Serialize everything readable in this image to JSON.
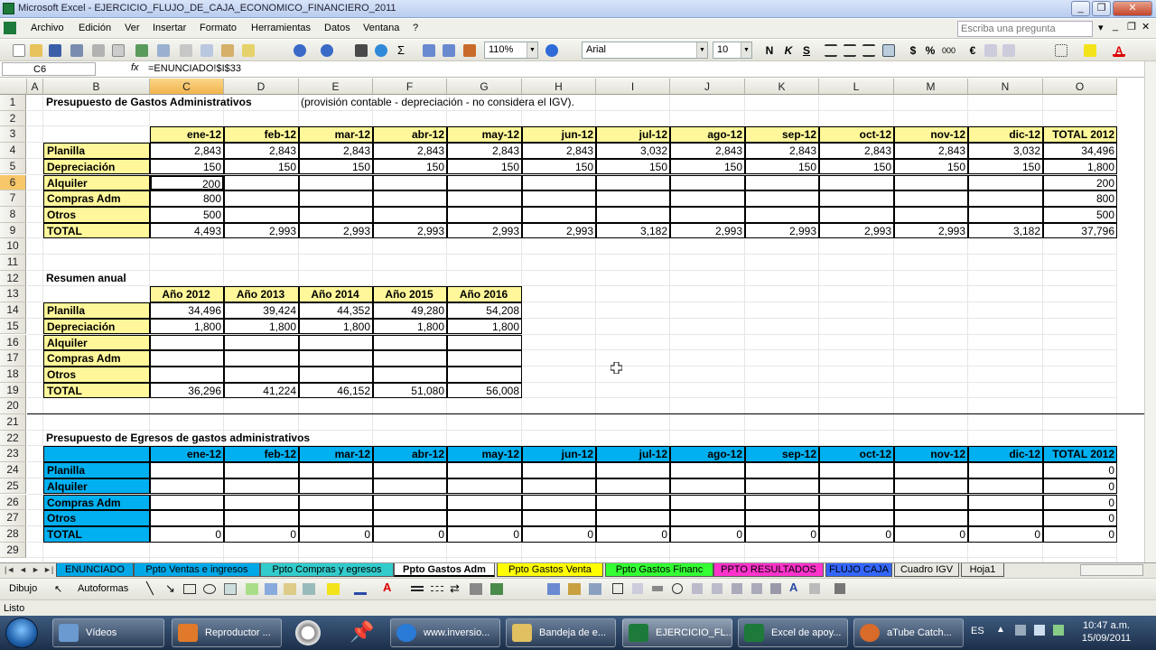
{
  "window": {
    "title": "Microsoft Excel - EJERCICIO_FLUJO_DE_CAJA_ECONOMICO_FINANCIERO_2011"
  },
  "menu": {
    "items": [
      "Archivo",
      "Edición",
      "Ver",
      "Insertar",
      "Formato",
      "Herramientas",
      "Datos",
      "Ventana",
      "?"
    ],
    "help_placeholder": "Escriba una pregunta"
  },
  "toolbar": {
    "zoom": "110%",
    "font": "Arial",
    "size": "10"
  },
  "formula_bar": {
    "name_box": "C6",
    "fx": "fx",
    "formula": "=ENUNCIADO!$I$33"
  },
  "columns": [
    "A",
    "B",
    "C",
    "D",
    "E",
    "F",
    "G",
    "H",
    "I",
    "J",
    "K",
    "L",
    "M",
    "N",
    "O"
  ],
  "rows": [
    "1",
    "2",
    "3",
    "4",
    "5",
    "6",
    "7",
    "8",
    "9",
    "10",
    "11",
    "12",
    "13",
    "14",
    "15",
    "16",
    "17",
    "18",
    "19",
    "20",
    "21",
    "22",
    "23",
    "24",
    "25",
    "26",
    "27",
    "28",
    "29"
  ],
  "sheet": {
    "title1": "Presupuesto de Gastos Administrativos",
    "subtitle1": "(provisión contable - depreciación - no considera el IGV).",
    "months": [
      "ene-12",
      "feb-12",
      "mar-12",
      "abr-12",
      "may-12",
      "jun-12",
      "jul-12",
      "ago-12",
      "sep-12",
      "oct-12",
      "nov-12",
      "dic-12",
      "TOTAL 2012"
    ],
    "t1_rows": [
      {
        "label": "Planilla",
        "values": [
          "2,843",
          "2,843",
          "2,843",
          "2,843",
          "2,843",
          "2,843",
          "3,032",
          "2,843",
          "2,843",
          "2,843",
          "2,843",
          "3,032",
          "34,496"
        ]
      },
      {
        "label": "Depreciación",
        "values": [
          "150",
          "150",
          "150",
          "150",
          "150",
          "150",
          "150",
          "150",
          "150",
          "150",
          "150",
          "150",
          "1,800"
        ]
      },
      {
        "label": "Alquiler",
        "values": [
          "200",
          "",
          "",
          "",
          "",
          "",
          "",
          "",
          "",
          "",
          "",
          "",
          "200"
        ]
      },
      {
        "label": "Compras Adm",
        "values": [
          "800",
          "",
          "",
          "",
          "",
          "",
          "",
          "",
          "",
          "",
          "",
          "",
          "800"
        ]
      },
      {
        "label": "Otros",
        "values": [
          "500",
          "",
          "",
          "",
          "",
          "",
          "",
          "",
          "",
          "",
          "",
          "",
          "500"
        ]
      },
      {
        "label": "TOTAL",
        "values": [
          "4,493",
          "2,993",
          "2,993",
          "2,993",
          "2,993",
          "2,993",
          "3,182",
          "2,993",
          "2,993",
          "2,993",
          "2,993",
          "3,182",
          "37,796"
        ]
      }
    ],
    "title2": "Resumen anual",
    "years": [
      "Año 2012",
      "Año 2013",
      "Año 2014",
      "Año 2015",
      "Año 2016"
    ],
    "t2_rows": [
      {
        "label": "Planilla",
        "values": [
          "34,496",
          "39,424",
          "44,352",
          "49,280",
          "54,208"
        ]
      },
      {
        "label": "Depreciación",
        "values": [
          "1,800",
          "1,800",
          "1,800",
          "1,800",
          "1,800"
        ]
      },
      {
        "label": "Alquiler",
        "values": [
          "",
          "",
          "",
          "",
          ""
        ]
      },
      {
        "label": "Compras Adm",
        "values": [
          "",
          "",
          "",
          "",
          ""
        ]
      },
      {
        "label": "Otros",
        "values": [
          "",
          "",
          "",
          "",
          ""
        ]
      },
      {
        "label": "TOTAL",
        "values": [
          "36,296",
          "41,224",
          "46,152",
          "51,080",
          "56,008"
        ]
      }
    ],
    "title3": "Presupuesto de Egresos de gastos administrativos",
    "t3_rows": [
      {
        "label": "Planilla",
        "values": [
          "",
          "",
          "",
          "",
          "",
          "",
          "",
          "",
          "",
          "",
          "",
          "",
          "0"
        ]
      },
      {
        "label": "Alquiler",
        "values": [
          "",
          "",
          "",
          "",
          "",
          "",
          "",
          "",
          "",
          "",
          "",
          "",
          "0"
        ]
      },
      {
        "label": "Compras Adm",
        "values": [
          "",
          "",
          "",
          "",
          "",
          "",
          "",
          "",
          "",
          "",
          "",
          "",
          "0"
        ]
      },
      {
        "label": "Otros",
        "values": [
          "",
          "",
          "",
          "",
          "",
          "",
          "",
          "",
          "",
          "",
          "",
          "",
          "0"
        ]
      },
      {
        "label": "TOTAL",
        "values": [
          "0",
          "0",
          "0",
          "0",
          "0",
          "0",
          "0",
          "0",
          "0",
          "0",
          "0",
          "0",
          "0"
        ]
      }
    ]
  },
  "tabs": [
    {
      "label": "ENUNCIADO",
      "color": "#00a8e8"
    },
    {
      "label": "Ppto Ventas e ingresos",
      "color": "#00a8e8"
    },
    {
      "label": "Ppto Compras y egresos",
      "color": "#33cccc"
    },
    {
      "label": "Ppto Gastos Adm",
      "color": "#ffffff"
    },
    {
      "label": "Ppto Gastos Venta",
      "color": "#ffff00"
    },
    {
      "label": "Ppto Gastos Financ",
      "color": "#33ff33"
    },
    {
      "label": "PPTO RESULTADOS",
      "color": "#ff33cc"
    },
    {
      "label": "FLUJO CAJA",
      "color": "#3366ff"
    },
    {
      "label": "Cuadro IGV",
      "color": "#e8e8e0"
    },
    {
      "label": "Hoja1",
      "color": "#e8e8e0"
    }
  ],
  "drawbar": {
    "dibujo": "Dibujo",
    "autoformas": "Autoformas"
  },
  "status": "Listo",
  "taskbar": {
    "items": [
      "Vídeos",
      "Reproductor ...",
      "www.inversio...",
      "Bandeja de e...",
      "EJERCICIO_FL...",
      "Excel de apoy...",
      "aTube Catch..."
    ],
    "lang": "ES",
    "time": "10:47 a.m.",
    "date": "15/09/2011"
  }
}
